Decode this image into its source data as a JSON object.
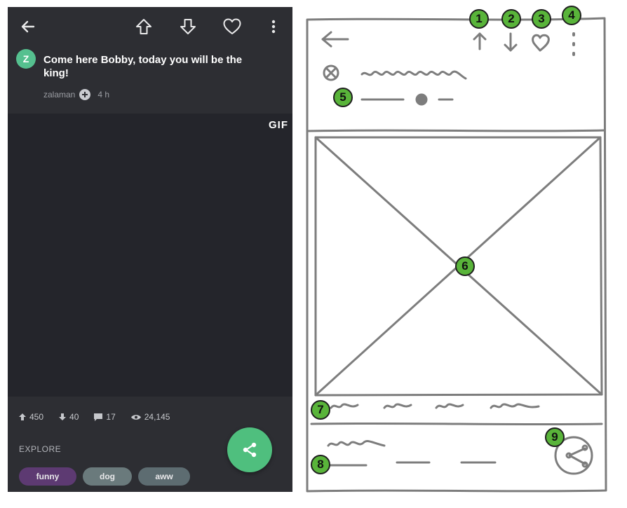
{
  "post": {
    "avatar_letter": "Z",
    "title": "Come here Bobby, today you will be the king!",
    "author": "zalaman",
    "age": "4 h",
    "media_badge": "GIF"
  },
  "toolbar": {
    "back_icon": "arrow-left-icon",
    "upvote_icon": "arrow-up-outline-icon",
    "downvote_icon": "arrow-down-outline-icon",
    "favorite_icon": "heart-outline-icon",
    "more_icon": "more-vertical-icon"
  },
  "stats": {
    "upvotes": "450",
    "downvotes": "40",
    "comments": "17",
    "views": "24,145"
  },
  "explore": {
    "label": "EXPLORE",
    "tags": [
      "funny",
      "dog",
      "aww"
    ]
  },
  "colors": {
    "accent_green": "#4fbf7e",
    "topbar_bg": "#2d2e33",
    "media_bg": "#24252b",
    "tag_funny": "#5d3a72",
    "tag_dog": "#6a7a7c",
    "tag_aww": "#5d6c71",
    "marker_green": "#59b43a"
  },
  "wireframe": {
    "markers": [
      "1",
      "2",
      "3",
      "4",
      "5",
      "6",
      "7",
      "8",
      "9"
    ]
  }
}
